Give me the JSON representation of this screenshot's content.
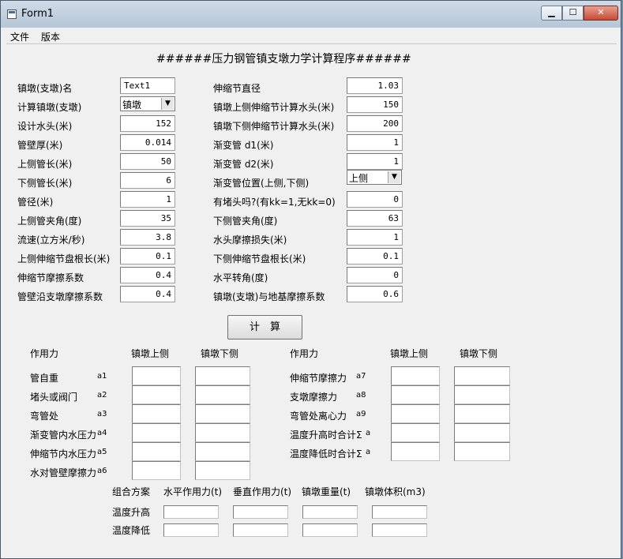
{
  "window": {
    "title": "Form1"
  },
  "menu": [
    "文件",
    "版本"
  ],
  "heading": "######压力钢管镇支墩力学计算程序######",
  "left_fields": [
    {
      "label": "镇墩(支墩)名",
      "value": "Text1"
    },
    {
      "label": "计算镇墩(支墩)",
      "value": "镇墩"
    },
    {
      "label": "设计水头(米)",
      "value": "152"
    },
    {
      "label": "管壁厚(米)",
      "value": "0.014"
    },
    {
      "label": "上侧管长(米)",
      "value": "50"
    },
    {
      "label": "下侧管长(米)",
      "value": "6"
    },
    {
      "label": "管径(米)",
      "value": "1"
    },
    {
      "label": "上侧管夹角(度)",
      "value": "35"
    },
    {
      "label": "流速(立方米/秒)",
      "value": "3.8"
    },
    {
      "label": "上侧伸缩节盘根长(米)",
      "value": "0.1"
    },
    {
      "label": "伸缩节摩擦系数",
      "value": "0.4"
    },
    {
      "label": "管壁沿支墩摩擦系数",
      "value": "0.4"
    }
  ],
  "right_fields": [
    {
      "label": "伸缩节直径",
      "value": "1.03"
    },
    {
      "label": "镇墩上侧伸缩节计算水头(米)",
      "value": "150"
    },
    {
      "label": "镇墩下侧伸缩节计算水头(米)",
      "value": "200"
    },
    {
      "label": "渐变管 d1(米)",
      "value": "1"
    },
    {
      "label": "渐变管 d2(米)",
      "value": "1"
    },
    {
      "label": "渐变管位置(上侧,下侧)",
      "value": "上侧"
    },
    {
      "label": "有堵头吗?(有kk=1,无kk=0)",
      "value": "0"
    },
    {
      "label": "下侧管夹角(度)",
      "value": "63"
    },
    {
      "label": "水头摩擦损失(米)",
      "value": "1"
    },
    {
      "label": "下侧伸缩节盘根长(米)",
      "value": "0.1"
    },
    {
      "label": "水平转角(度)",
      "value": "0"
    },
    {
      "label": "镇墩(支墩)与地基摩擦系数",
      "value": "0.6"
    }
  ],
  "compute_button": "计　算",
  "forces_left": {
    "col_force": "作用力",
    "col_upper": "镇墩上侧",
    "col_lower": "镇墩下侧",
    "rows": [
      {
        "name": "管自重",
        "code": "a1"
      },
      {
        "name": "堵头或阀门",
        "code": "a2"
      },
      {
        "name": "弯管处",
        "code": "a3"
      },
      {
        "name": "渐变管内水压力",
        "code": "a4"
      },
      {
        "name": "伸缩节内水压力",
        "code": "a5"
      },
      {
        "name": "水对管壁摩擦力",
        "code": "a6"
      }
    ]
  },
  "forces_right": {
    "col_force": "作用力",
    "col_upper": "镇墩上侧",
    "col_lower": "镇墩下侧",
    "rows": [
      {
        "name": "伸缩节摩擦力",
        "code": "a7"
      },
      {
        "name": "支墩摩擦力",
        "code": "a8"
      },
      {
        "name": "弯管处离心力",
        "code": "a9"
      },
      {
        "name": "温度升高时合计Σ",
        "code": "a"
      },
      {
        "name": "温度降低时合计Σ",
        "code": "a"
      }
    ]
  },
  "combo": {
    "headers": [
      "组合方案",
      "水平作用力(t)",
      "垂直作用力(t)",
      "镇墩重量(t)",
      "镇墩体积(m3)"
    ],
    "rows": [
      "温度升高",
      "温度降低"
    ]
  }
}
